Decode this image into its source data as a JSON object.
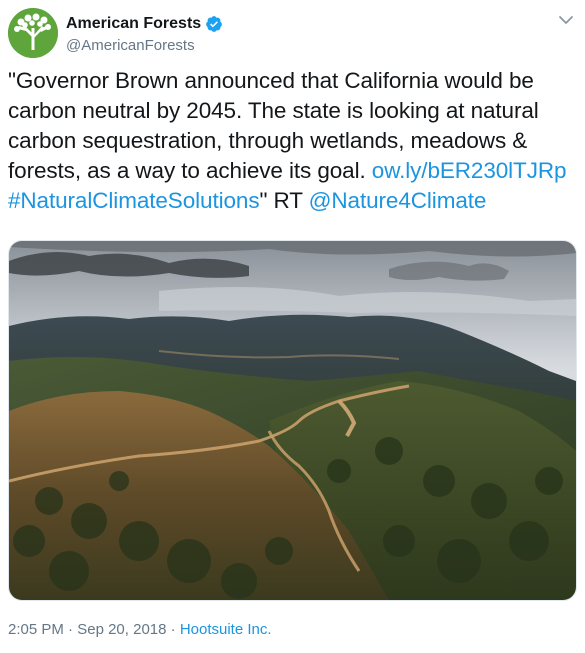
{
  "account": {
    "display_name": "American Forests",
    "handle": "@AmericanForests"
  },
  "tweet": {
    "text_main": "\"Governor Brown announced that California would be carbon neutral by 2045. The state is looking at natural carbon sequestration, through wetlands, meadows & forests, as a way to achieve its goal. ",
    "link": "ow.ly/bER230lTJRp",
    "hashtag": "#NaturalClimateSolutions",
    "quote_close": "\" RT ",
    "mention": "@Nature4Climate"
  },
  "meta": {
    "time": "2:05 PM",
    "separator1": " · ",
    "date": "Sep 20, 2018",
    "separator2": " · ",
    "source": "Hootsuite Inc."
  },
  "icons": {
    "avatar": "tree-logo-icon",
    "verified": "verified-badge-icon",
    "menu": "chevron-down-icon"
  },
  "colors": {
    "link": "#1b95e0",
    "avatar_bg": "#5ea63b",
    "muted": "#657786"
  }
}
